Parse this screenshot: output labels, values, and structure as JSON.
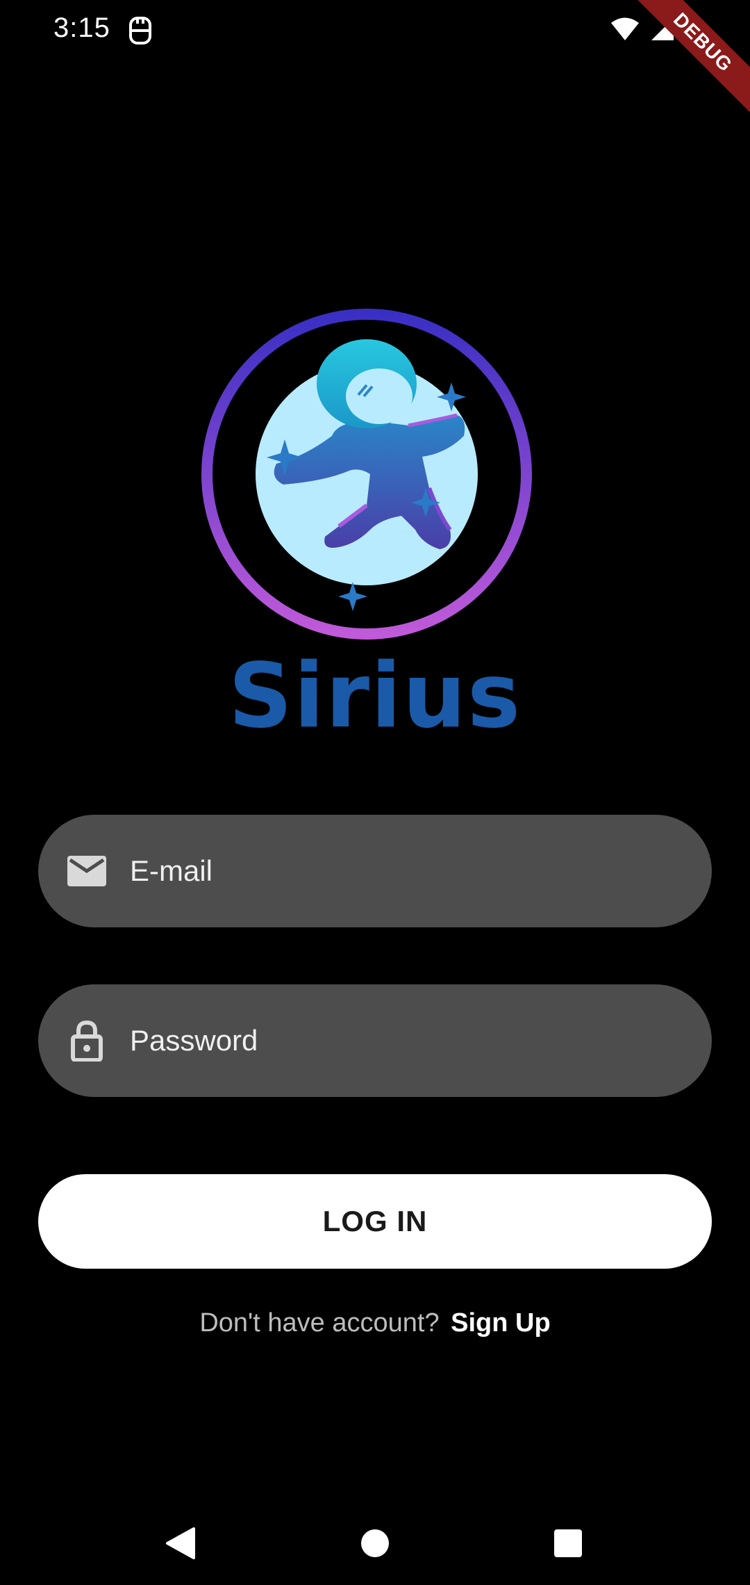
{
  "status_bar": {
    "time": "3:15"
  },
  "debug_banner": {
    "label": "DEBUG"
  },
  "brand": {
    "name": "Sirius",
    "color": "#1a5aa8"
  },
  "form": {
    "email": {
      "placeholder": "E-mail",
      "value": "",
      "icon": "mail-icon"
    },
    "password": {
      "placeholder": "Password",
      "value": "",
      "icon": "lock-icon"
    },
    "login_label": "LOG IN",
    "signup_prompt": "Don't have account?",
    "signup_link": "Sign Up"
  },
  "navigation": {
    "back_icon": "back-icon",
    "home_icon": "home-icon",
    "recents_icon": "recents-icon"
  },
  "colors": {
    "background": "#000000",
    "field_background": "#4d4d4d",
    "button_background": "#ffffff",
    "logo_ring_top": "#3a2fc4",
    "logo_ring_bottom": "#c05ad9",
    "logo_moon": "#b9ebff"
  }
}
